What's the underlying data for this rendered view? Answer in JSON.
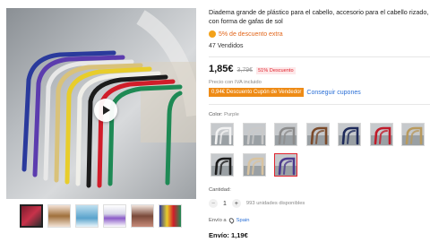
{
  "product": {
    "title": "Diadema grande de plástico para el cabello, accesorio para el cabello rizado, con forma de gafas de sol",
    "extra_discount": "5% de descuento extra",
    "sold": "47 Vendidos"
  },
  "price": {
    "current": "1,85€",
    "original": "3,79€",
    "badge": "51% Descuento",
    "vat": "Precio con IVA incluido",
    "coupon_tag": "0,94€ Descuento Cupón de Vendedor",
    "coupon_link": "Conseguir cupones"
  },
  "color": {
    "label": "Color:",
    "value": "Purple",
    "swatches": [
      "white",
      "silver",
      "gray",
      "brown",
      "navy",
      "red",
      "khaki",
      "black",
      "beige",
      "purple"
    ],
    "swatch_colors": [
      "#f2f2f2",
      "#c9c9c9",
      "#8c8c8c",
      "#7b4a2a",
      "#1e2a5a",
      "#c01b2a",
      "#b89a5e",
      "#1b1b1b",
      "#d8c3a0",
      "#4b3a8c"
    ],
    "selected_index": 9
  },
  "quantity": {
    "label": "Cantidad:",
    "minus": "−",
    "value": "1",
    "plus": "+",
    "stock": "993 unidades disponibles"
  },
  "shipping": {
    "label": "Envío a",
    "country": "Spain",
    "price": "Envío: 1,19€"
  },
  "gallery": {
    "thumb_count": 6,
    "active_index": 0
  },
  "colors": {
    "accent": "#e1232e",
    "coupon": "#ee8b16",
    "link": "#2a6fd6",
    "discount": "#e2661b"
  }
}
